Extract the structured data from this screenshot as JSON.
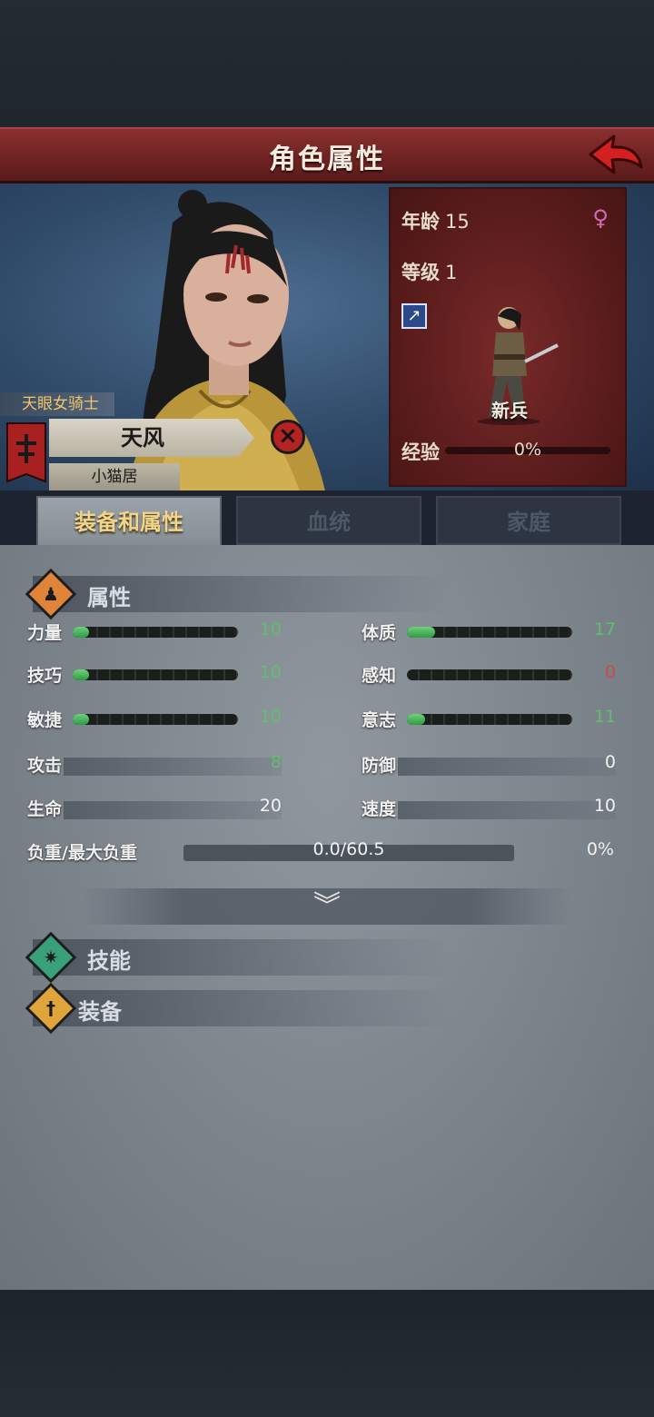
{
  "header": {
    "title": "角色属性"
  },
  "info": {
    "age_label": "年龄",
    "age": "15",
    "level_label": "等级",
    "level": "1",
    "class_name": "新兵",
    "xp_label": "经验",
    "xp_text": "0%",
    "xp_progress": 0
  },
  "character": {
    "title": "天眼女骑士",
    "name": "天风",
    "house": "小猫居"
  },
  "tabs": [
    {
      "label": "装备和属性",
      "active": true
    },
    {
      "label": "血统",
      "active": false
    },
    {
      "label": "家庭",
      "active": false
    }
  ],
  "sections": {
    "attributes": "属性",
    "skills": "技能",
    "equipment": "装备"
  },
  "stats_left": [
    {
      "label": "力量",
      "value": "10",
      "fill": 0.1
    },
    {
      "label": "技巧",
      "value": "10",
      "fill": 0.1
    },
    {
      "label": "敏捷",
      "value": "10",
      "fill": 0.1
    }
  ],
  "stats_right": [
    {
      "label": "体质",
      "value": "17",
      "fill": 0.17
    },
    {
      "label": "感知",
      "value": "0",
      "fill": 0
    },
    {
      "label": "意志",
      "value": "11",
      "fill": 0.11
    }
  ],
  "combat": {
    "attack_label": "攻击",
    "attack": "8",
    "defense_label": "防御",
    "defense": "0",
    "hp_label": "生命",
    "hp": "20",
    "speed_label": "速度",
    "speed": "10"
  },
  "load": {
    "label": "负重/最大负重",
    "value": "0.0/60.5",
    "percent": "0%"
  },
  "colors": {
    "header_red": "#6e2222",
    "stat_green": "#5fbf6a",
    "stat_zero": "#d64545",
    "tab_gold": "#f2d58a"
  },
  "icons": {
    "back": "back-arrow-icon",
    "gender": "female-icon",
    "weapon": "sword-icon",
    "dismiss": "close-icon",
    "attributes": "person-icon",
    "skills": "star-icon",
    "equipment": "sword-icon",
    "expand": "chevron-double-down-icon"
  }
}
